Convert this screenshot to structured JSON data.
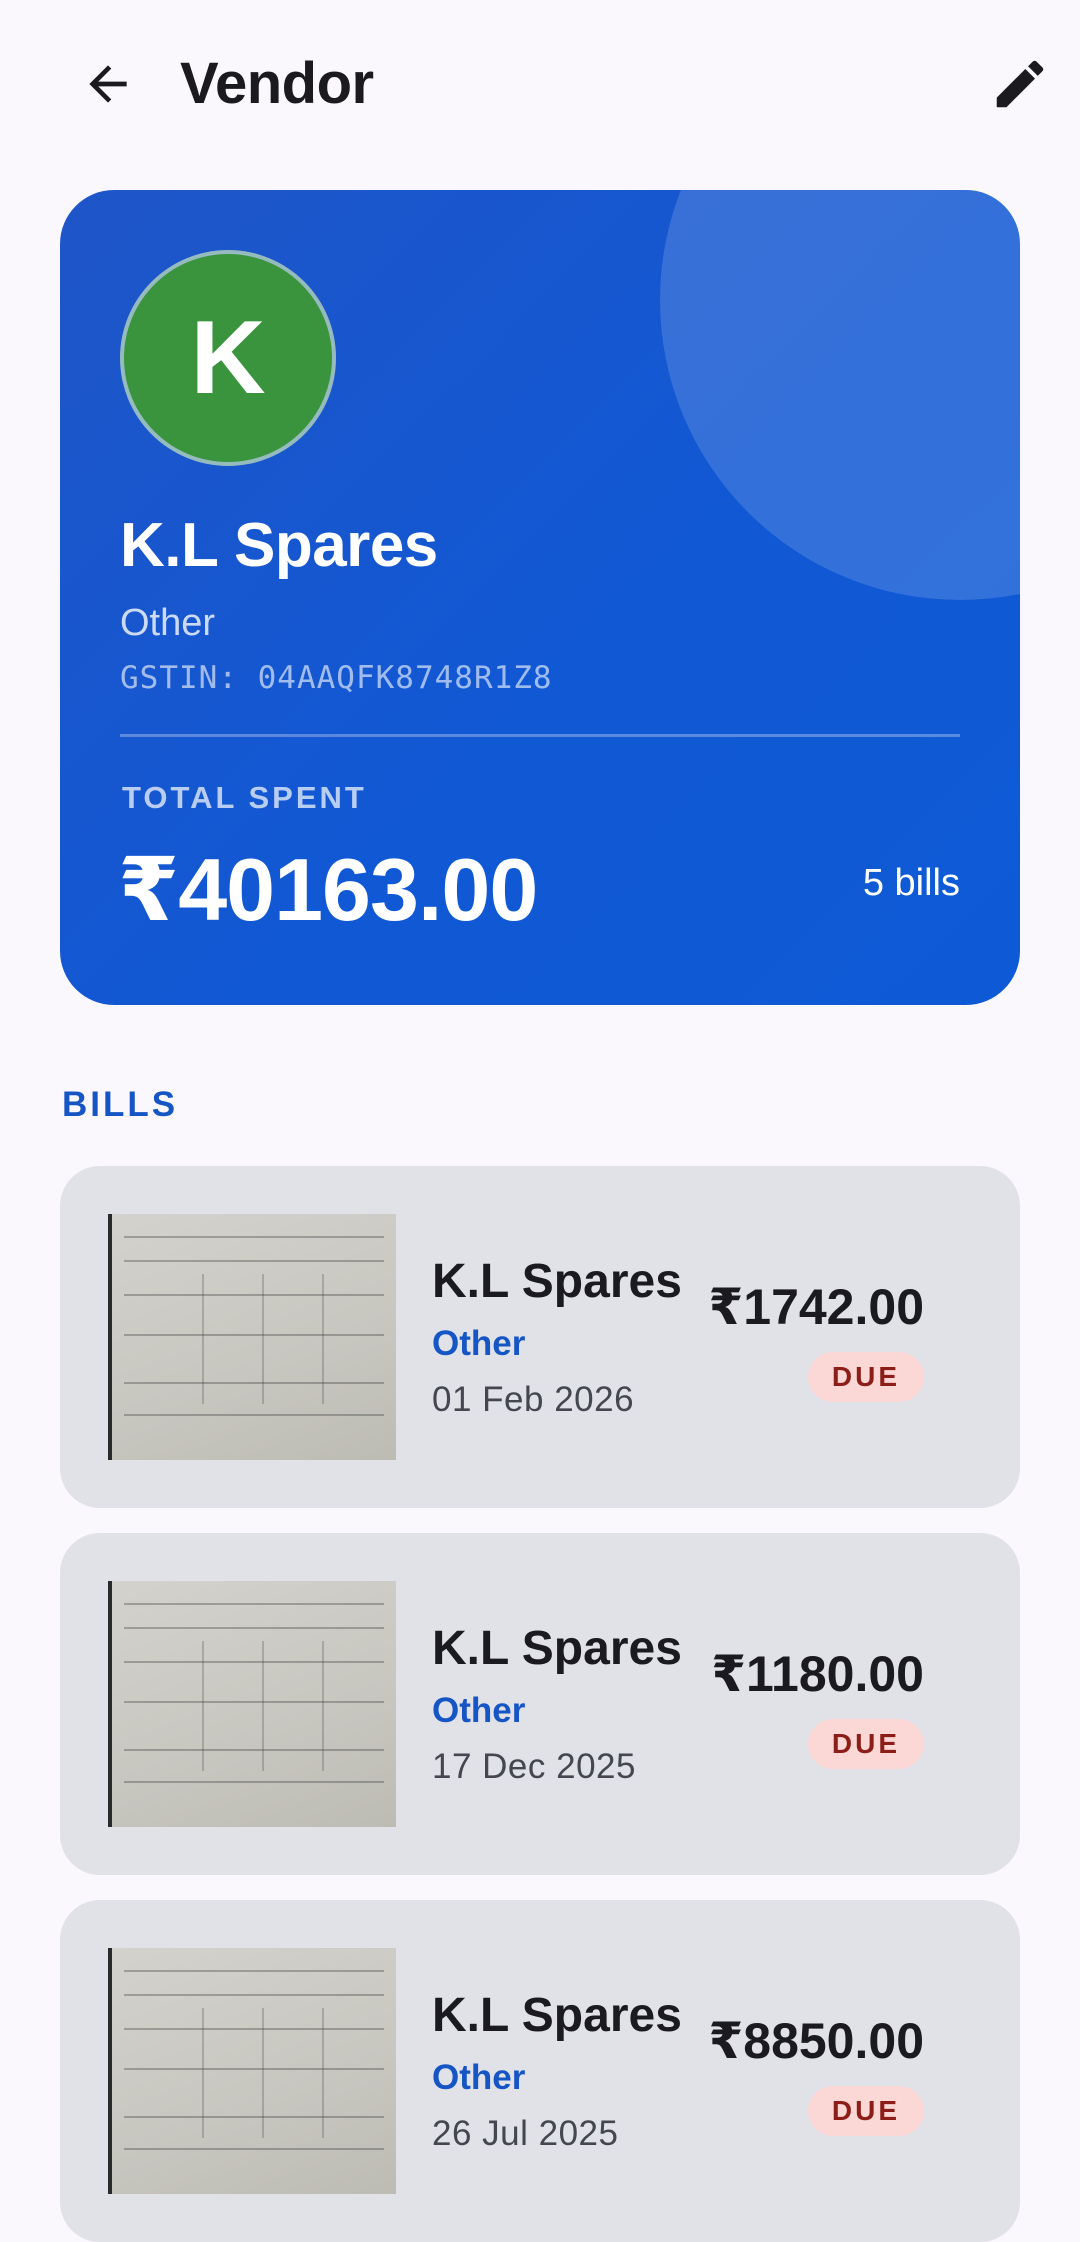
{
  "app_bar": {
    "title": "Vendor",
    "back_icon": "arrow-back-icon",
    "edit_icon": "pencil-icon"
  },
  "vendor": {
    "initial": "K",
    "name": "K.L Spares",
    "category": "Other",
    "gstin": "GSTIN: 04AAQFK8748R1Z8",
    "total_label": "TOTAL SPENT",
    "total_amount": "₹40163.00",
    "bill_count": "5 bills",
    "avatar_color": "#3a943d",
    "card_color": "#1158d4"
  },
  "bills_section": {
    "label": "BILLS"
  },
  "bills": [
    {
      "vendor": "K.L Spares",
      "category": "Other",
      "date": "01 Feb 2026",
      "amount": "₹1742.00",
      "status": "DUE"
    },
    {
      "vendor": "K.L Spares",
      "category": "Other",
      "date": "17 Dec 2025",
      "amount": "₹1180.00",
      "status": "DUE"
    },
    {
      "vendor": "K.L Spares",
      "category": "Other",
      "date": "26 Jul 2025",
      "amount": "₹8850.00",
      "status": "DUE"
    }
  ],
  "colors": {
    "accent": "#1555c4",
    "due_bg": "#fbd7d5",
    "due_text": "#8c1d18"
  }
}
